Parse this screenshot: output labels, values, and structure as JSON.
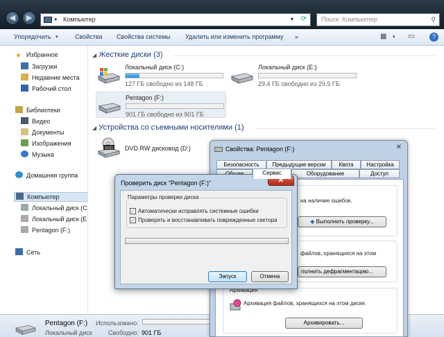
{
  "explorer": {
    "breadcrumb": "Компьютер",
    "search_placeholder": "Поиск: Компьютер",
    "toolbar": {
      "organize": "Упорядочить",
      "properties": "Свойства",
      "system_properties": "Свойства системы",
      "uninstall": "Удалить или изменить программу",
      "more": "»"
    },
    "nav": {
      "favorites": "Избранное",
      "downloads": "Загрузки",
      "recent": "Недавние места",
      "desktop": "Рабочий стол",
      "libraries": "Библиотеки",
      "video": "Видео",
      "documents": "Документы",
      "pictures": "Изображения",
      "music": "Музыка",
      "homegroup": "Домашняя группа",
      "computer": "Компьютер",
      "local_c": "Локальный диск (C",
      "local_e": "Локальный диск (E:",
      "pentagon": "Pentagon (F:)",
      "network": "Сеть"
    },
    "groups": {
      "hard_disks": "Жесткие диски (3)",
      "removable": "Устройства со съемными носителями (1)"
    },
    "drives": [
      {
        "name": "Локальный диск (C:)",
        "info": "127 ГБ свободно из 148 ГБ",
        "used_fraction": 0.14
      },
      {
        "name": "Локальный диск (E:)",
        "info": "29,4 ГБ свободно из 29,5 ГБ",
        "used_fraction": 0.0
      },
      {
        "name": "Pentagon (F:)",
        "info": "901 ГБ свободно из 901 ГБ",
        "used_fraction": 0.0
      }
    ],
    "dvd": {
      "name": "DVD RW дисковод (D:)",
      "badge": "DVD"
    },
    "status": {
      "name": "Pentagon (F:)",
      "type": "Локальный диск",
      "used_label": "Использовано:",
      "free_label": "Свободно:",
      "free_value": "901 ГБ"
    }
  },
  "properties_dialog": {
    "title": "Свойства: Pentagon (F:)",
    "tabs_top": [
      "Безопасность",
      "Предыдущие версии",
      "Квота",
      "Настройка"
    ],
    "tabs_bottom": [
      "Общие",
      "Сервис",
      "Оборудование",
      "Доступ"
    ],
    "check_text": "на наличие ошибок.",
    "check_button": "Выполнить проверку...",
    "defrag_text": "файлов, хранящихся на этом",
    "defrag_button": "полнить дефрагментацию...",
    "archive_label": "Архивация",
    "archive_text": "Архивация файлов, хранящихся на этом диске.",
    "archive_button": "Архивировать..."
  },
  "check_dialog": {
    "title": "Проверить диск \"Pentagon (F:)\"",
    "close": "✕",
    "group_label": "Параметры проверки диска",
    "option1": "Автоматически исправлять системные ошибки",
    "option2": "Проверять и восстанавливать поврежденные сектора",
    "option1_checked": true,
    "option2_checked": true,
    "start": "Запуск",
    "cancel": "Отмена"
  }
}
